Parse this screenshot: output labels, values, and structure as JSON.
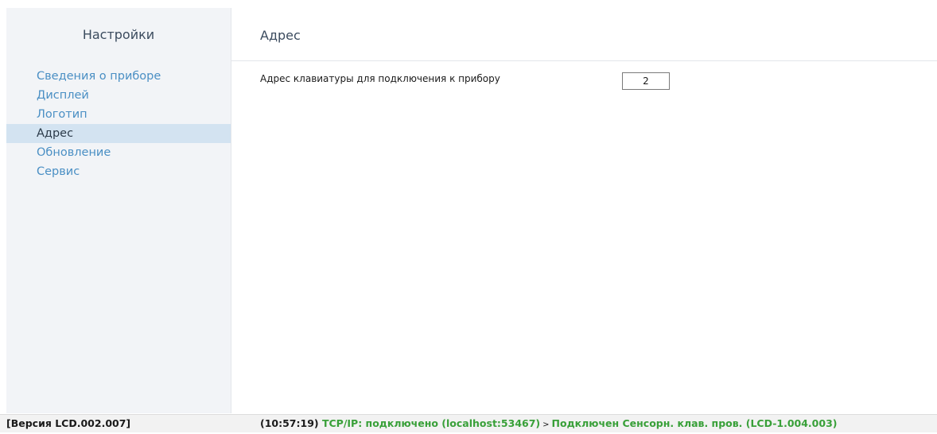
{
  "sidebar": {
    "title": "Настройки",
    "items": [
      {
        "label": "Сведения о приборе",
        "active": false
      },
      {
        "label": "Дисплей",
        "active": false
      },
      {
        "label": "Логотип",
        "active": false
      },
      {
        "label": "Адрес",
        "active": true
      },
      {
        "label": "Обновление",
        "active": false
      },
      {
        "label": "Сервис",
        "active": false
      }
    ]
  },
  "main": {
    "title": "Адрес",
    "field": {
      "label": "Адрес клавиатуры для подключения к прибору",
      "value": "2"
    }
  },
  "statusbar": {
    "version": "[Версия LCD.002.007]",
    "time": "(10:57:19)",
    "connection": "TCP/IP: подключено (localhost:53467)",
    "separator": ">",
    "device": "Подключен Сенсорн. клав. пров. (LCD-1.004.003)"
  },
  "colors": {
    "sidebar_bg": "#f2f4f7",
    "active_item_bg": "#d3e3f1",
    "link": "#4a8fc4",
    "status_ok": "#39a039"
  }
}
